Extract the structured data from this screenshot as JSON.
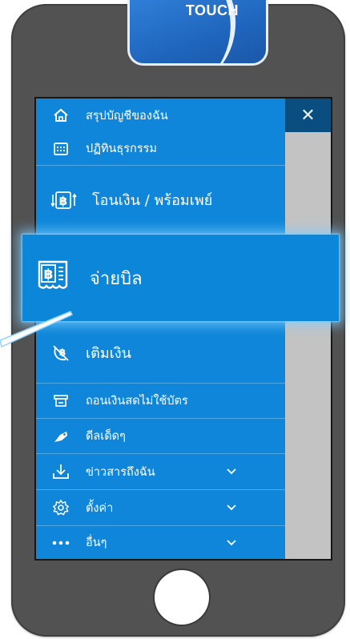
{
  "app_logo": {
    "text": "TOUCH",
    "icon": "app-logo-swoosh"
  },
  "close_button": {
    "label": "✕"
  },
  "menu": {
    "items": [
      {
        "label": "สรุปบัญชีของฉัน",
        "icon": "home-icon"
      },
      {
        "label": "ปฏิทินธุรกรรม",
        "icon": "calendar-icon"
      },
      {
        "label": "โอนเงิน / พร้อมเพย์",
        "icon": "transfer-baht-icon"
      },
      {
        "label": "จ่ายบิล",
        "icon": "bill-baht-icon"
      },
      {
        "label": "เติมเงิน",
        "icon": "topup-icon"
      },
      {
        "label": "ถอนเงินสดไม่ใช้บัตร",
        "icon": "atm-icon"
      },
      {
        "label": "ดีลเด็ดๆ",
        "icon": "tag-icon"
      },
      {
        "label": "ข่าวสารถึงฉัน",
        "icon": "download-icon",
        "has_chevron": true
      },
      {
        "label": "ตั้งค่า",
        "icon": "gear-icon",
        "has_chevron": true
      },
      {
        "label": "อื่นๆ",
        "icon": "more-icon",
        "has_chevron": true
      }
    ]
  },
  "colors": {
    "menu_bg": "#0f86d9",
    "close_bg": "#0a4e80",
    "phone": "#525252",
    "highlight_glow": "#7ecbff"
  }
}
